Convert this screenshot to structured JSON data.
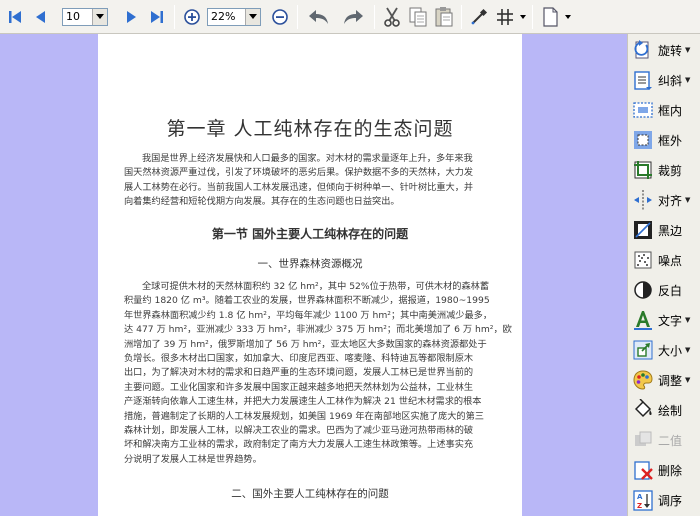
{
  "toolbar": {
    "page_number": "10",
    "zoom": "22%"
  },
  "document": {
    "chapter_title": "第一章    人工纯林存在的生态问题",
    "intro_lines": [
      "我国是世界上经济发展快和人口最多的国家。对木材的需求量逐年上升，多年来我",
      "国天然林资源严重过伐，引发了环境破坏的恶劣后果。保护数据不多的天然林，大力发",
      "展人工林势在必行。当前我国人工林发展迅速，但倾向于树种单一、针叶树比重大，并",
      "向着集约经营和短轮伐期方向发展。其存在的生态问题也日益突出。"
    ],
    "section_title": "第一节    国外主要人工纯林存在的问题",
    "sub1_title": "一、世界森林资源概况",
    "body_lines": [
      "全球可提供木材的天然林面积约 32 亿 hm²，其中 52%位于热带，可供木材的森林蓄",
      "积量约 1820 亿 m³。随着工农业的发展，世界森林面积不断减少，据报道，1980~1995",
      "年世界森林面积减少约 1.8 亿 hm²，平均每年减少 1100 万 hm²；其中南美洲减少最多，",
      "达 477 万 hm²，亚洲减少 333 万 hm²，非洲减少 375 万 hm²；而北美增加了 6 万 hm²，欧",
      "洲增加了 39 万 hm²，俄罗斯增加了 56 万 hm²，亚太地区大多数国家的森林资源都处于",
      "负增长。很多木材出口国家，如加拿大、印度尼西亚、喀麦隆、科特迪瓦等都限制原木",
      "出口，为了解决对木材的需求和日趋严重的生态环境问题，发展人工林已是世界当前的",
      "主要问题。工业化国家和许多发展中国家正越来越多地把天然林划为公益林，工业林生",
      "产逐渐转向依靠人工速生林，并把大力发展速生人工林作为解决 21 世纪木材需求的根本",
      "措施，普遍制定了长期的人工林发展规划，如美国 1969 年在南部地区实施了庞大的第三",
      "森林计划，即发展人工林，以解决工农业的需求。巴西为了减少亚马逊河热带雨林的破",
      "坏和解决南方工业林的需求，政府制定了南方大力发展人工速生林政策等。上述事实充",
      "分说明了发展人工林是世界趋势。"
    ],
    "sub2_title": "二、国外主要人工纯林存在的问题"
  },
  "right_panel": {
    "items": [
      {
        "label": "旋转",
        "caret": true
      },
      {
        "label": "纠斜",
        "caret": true
      },
      {
        "label": "框内",
        "caret": false
      },
      {
        "label": "框外",
        "caret": false
      },
      {
        "label": "裁剪",
        "caret": false
      },
      {
        "label": "对齐",
        "caret": true
      },
      {
        "label": "黑边",
        "caret": false
      },
      {
        "label": "噪点",
        "caret": false
      },
      {
        "label": "反白",
        "caret": false
      },
      {
        "label": "文字",
        "caret": true
      },
      {
        "label": "大小",
        "caret": true
      },
      {
        "label": "调整",
        "caret": true
      },
      {
        "label": "绘制",
        "caret": false
      },
      {
        "label": "二值",
        "caret": false
      },
      {
        "label": "删除",
        "caret": false
      },
      {
        "label": "调序",
        "caret": false
      }
    ]
  },
  "colors": {
    "workspace": "#b9b7f7",
    "toolbar_bg": "#f3f2ee",
    "nav_arrow": "#2f6fd0"
  }
}
